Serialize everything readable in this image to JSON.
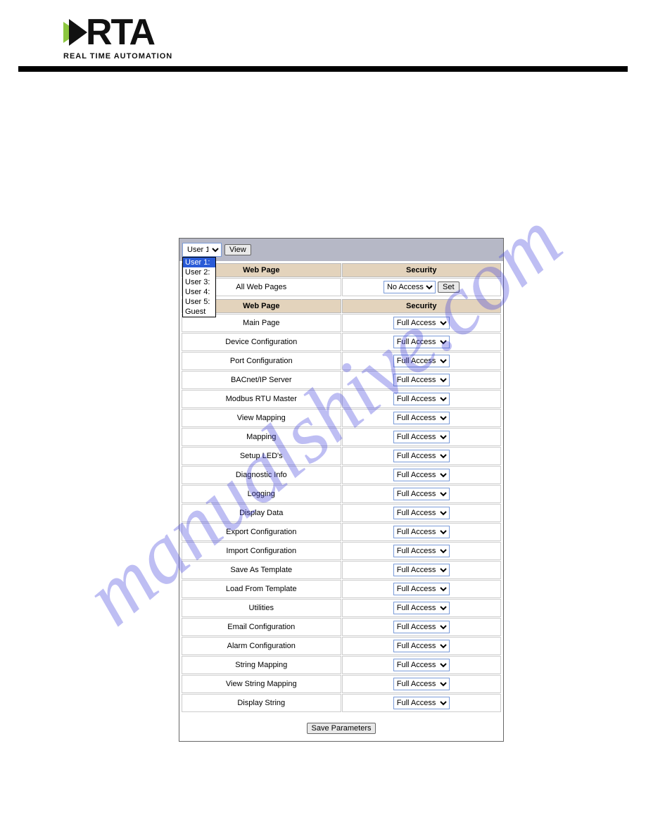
{
  "logo": {
    "text": "RTA",
    "sub": "REAL TIME AUTOMATION"
  },
  "watermark": "manualshive.com",
  "topbar": {
    "user_selected": "User 1:",
    "view_label": "View",
    "dropdown": [
      "User 1:",
      "User 2:",
      "User 3:",
      "User 4:",
      "User 5:",
      "Guest"
    ]
  },
  "headers": {
    "webpage": "Web Page",
    "security": "Security"
  },
  "all_row": {
    "label": "All Web Pages",
    "access": "No Access",
    "set_label": "Set"
  },
  "access_option": "Full Access",
  "pages": [
    "Main Page",
    "Device Configuration",
    "Port Configuration",
    "BACnet/IP Server",
    "Modbus RTU Master",
    "View Mapping",
    "Mapping",
    "Setup LED's",
    "Diagnostic Info",
    "Logging",
    "Display Data",
    "Export Configuration",
    "Import Configuration",
    "Save As Template",
    "Load From Template",
    "Utilities",
    "Email Configuration",
    "Alarm Configuration",
    "String Mapping",
    "View String Mapping",
    "Display String"
  ],
  "save_label": "Save Parameters"
}
